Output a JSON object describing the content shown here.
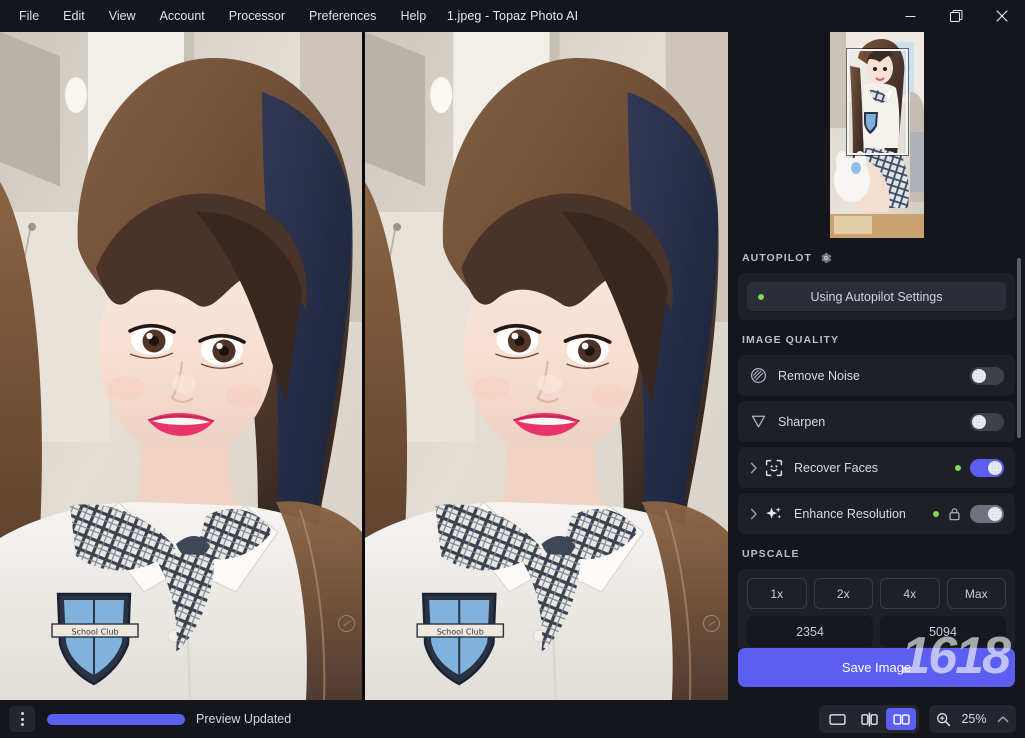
{
  "app": {
    "title": "1.jpeg - Topaz Photo AI",
    "accent": "#5b5ef0",
    "panel_bg": "#15161c",
    "card_bg": "#1e2028",
    "status_green": "#7ed957"
  },
  "menubar": {
    "items": [
      {
        "label": "File"
      },
      {
        "label": "Edit"
      },
      {
        "label": "View"
      },
      {
        "label": "Account"
      },
      {
        "label": "Processor"
      },
      {
        "label": "Preferences"
      },
      {
        "label": "Help"
      }
    ]
  },
  "window_controls": {
    "minimize": "minimize-icon",
    "maximize": "maximize-icon",
    "close": "close-icon"
  },
  "viewer": {
    "mode": "side-by-side",
    "left_pane_label": "original",
    "right_pane_label": "preview"
  },
  "navigator": {
    "name": "navigator-thumbnail",
    "viewport_rect_visible": true
  },
  "panel": {
    "autopilot": {
      "section_label": "AUTOPILOT",
      "gear_icon": "gear-icon",
      "pill_label": "Using Autopilot Settings",
      "pill_status_dot": "#7ed957"
    },
    "image_quality": {
      "section_label": "IMAGE QUALITY",
      "rows": [
        {
          "label": "Remove Noise",
          "icon": "remove-noise-icon",
          "expandable": false,
          "status_dot": false,
          "locked": false,
          "toggle": "off"
        },
        {
          "label": "Sharpen",
          "icon": "sharpen-icon",
          "expandable": false,
          "status_dot": false,
          "locked": false,
          "toggle": "off"
        },
        {
          "label": "Recover Faces",
          "icon": "recover-faces-icon",
          "expandable": true,
          "status_dot": true,
          "locked": false,
          "toggle": "on"
        },
        {
          "label": "Enhance Resolution",
          "icon": "enhance-resolution-icon",
          "expandable": true,
          "status_dot": true,
          "locked": true,
          "toggle": "locked"
        }
      ]
    },
    "upscale": {
      "section_label": "UPSCALE",
      "factors": [
        {
          "label": "1x",
          "active": false
        },
        {
          "label": "2x",
          "active": false
        },
        {
          "label": "4x",
          "active": false
        },
        {
          "label": "Max",
          "active": false
        }
      ],
      "width_value": "2354",
      "height_value": "5094"
    },
    "save": {
      "label": "Save Image",
      "brand_watermark": "1618"
    }
  },
  "statusbar": {
    "menu_icon": "kebab-menu-icon",
    "progress_percent": 100,
    "status_text": "Preview Updated",
    "view_modes": [
      {
        "name": "single-view",
        "icon": "single-pane-icon",
        "active": false
      },
      {
        "name": "split-view",
        "icon": "split-pane-icon",
        "active": false
      },
      {
        "name": "side-by-side-view",
        "icon": "side-by-side-icon",
        "active": true
      }
    ],
    "zoom_icon": "zoom-magnifier-icon",
    "zoom_value": "25%",
    "zoom_chevron": "chevron-up-icon"
  }
}
